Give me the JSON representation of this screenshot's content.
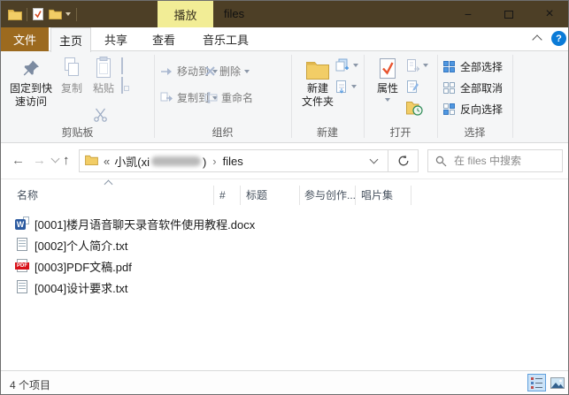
{
  "titlebar": {
    "contextual_tab": "播放",
    "title": "files",
    "minimize_glyph": "−",
    "close_glyph": "×"
  },
  "tabs": {
    "file": "文件",
    "home": "主页",
    "share": "共享",
    "view": "查看",
    "music": "音乐工具"
  },
  "ribbon": {
    "help_glyph": "?",
    "clipboard": {
      "group": "剪贴板",
      "pin_line1": "固定到快",
      "pin_line2": "速访问",
      "copy": "复制",
      "paste": "粘贴"
    },
    "organize": {
      "group": "组织",
      "move_to": "移动到",
      "delete": "删除",
      "copy_to": "复制到",
      "rename": "重命名"
    },
    "new": {
      "group": "新建",
      "new_folder_line1": "新建",
      "new_folder_line2": "文件夹"
    },
    "open": {
      "group": "打开",
      "properties": "属性"
    },
    "select": {
      "group": "选择",
      "select_all": "全部选择",
      "select_none": "全部取消",
      "invert": "反向选择"
    }
  },
  "navbar": {
    "crumb_overflow": "«",
    "crumb_user": "小凯(xi",
    "crumb_user_end": ")",
    "crumb_sep": "›",
    "crumb_current": "files",
    "search_placeholder": "在 files 中搜索"
  },
  "list": {
    "columns": [
      {
        "label": "名称"
      },
      {
        "label": "#"
      },
      {
        "label": "标题"
      },
      {
        "label": "参与创作..."
      },
      {
        "label": "唱片集"
      }
    ],
    "files": [
      {
        "icon": "word-icon",
        "badge": "W",
        "name": "[0001]楼月语音聊天录音软件使用教程.docx"
      },
      {
        "icon": "text-icon",
        "name": "[0002]个人简介.txt"
      },
      {
        "icon": "pdf-icon",
        "badge": "PDF",
        "name": "[0003]PDF文稿.pdf"
      },
      {
        "icon": "text-icon",
        "name": "[0004]设计要求.txt"
      }
    ]
  },
  "statusbar": {
    "items": "4 个项目"
  },
  "colors": {
    "titlebar": "#4d3f26",
    "contextual_tab_bg": "#f2ed96",
    "file_tab_bg": "#9c6a1f",
    "help_blue": "#0b7bd7",
    "selection_blue": "#4f97e0"
  }
}
